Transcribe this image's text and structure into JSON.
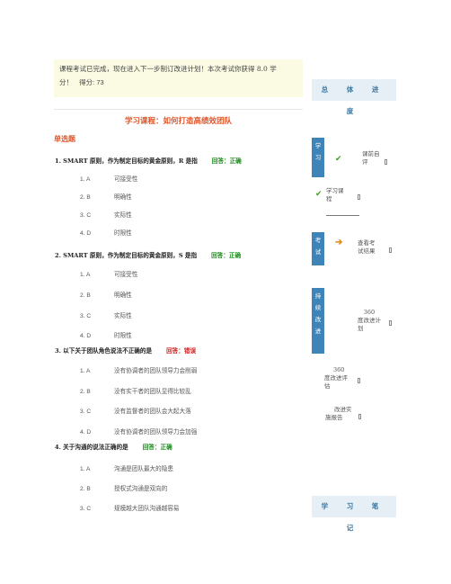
{
  "notice": {
    "line1": "课程考试已完成，现在进入下一步制订改进计划！本次考试你获得 8.0 学",
    "line2": "分！",
    "score_label": "得分: 73"
  },
  "course_title": "学习课程：如何打造高绩效团队",
  "section_title": "单选题",
  "questions": [
    {
      "text": "1. SMART 原则，作为制定目标的黄金原则，R 是指",
      "answer": "回答：正确",
      "options": [
        {
          "key": "1. A",
          "text": "可接受性"
        },
        {
          "key": "2. B",
          "text": "明确性"
        },
        {
          "key": "3. C",
          "text": "实际性"
        },
        {
          "key": "4. D",
          "text": "时限性"
        }
      ]
    },
    {
      "text": "2. SMART 原则，作为制定目标的黄金原则，S 是指",
      "answer": "回答：正确",
      "options": [
        {
          "key": "1. A",
          "text": "可接受性"
        },
        {
          "key": "2. B",
          "text": "明确性"
        },
        {
          "key": "3. C",
          "text": "实际性"
        },
        {
          "key": "4. D",
          "text": "时限性"
        }
      ]
    },
    {
      "text": "3. 以下关于团队角色说法不正确的是",
      "answer": "回答：错误",
      "options": [
        {
          "key": "1. A",
          "text": "没有协调者的团队领导力会削弱"
        },
        {
          "key": "2. B",
          "text": "没有实干者的团队显得比较乱"
        },
        {
          "key": "3. C",
          "text": "没有监督者的团队会大起大落"
        },
        {
          "key": "4. D",
          "text": "没有协调者的团队领导力会加强"
        }
      ]
    },
    {
      "text": "4. 关于沟通的说法正确的是",
      "answer": "回答：正确",
      "options": [
        {
          "key": "1. A",
          "text": "沟通是团队最大的隐患"
        },
        {
          "key": "2. B",
          "text": "授权式沟通是双向的"
        },
        {
          "key": "3. C",
          "text": "规模越大团队沟通越容易"
        }
      ]
    }
  ],
  "sidebar": {
    "progress_title": "总 体 进 度",
    "tab_study": [
      "学",
      "习"
    ],
    "tab_exam": [
      "考",
      "试"
    ],
    "tab_improve": [
      "持",
      "续",
      "改",
      "进"
    ],
    "item_precourse_1": "课前自",
    "item_precourse_2": "评",
    "item_study_1": "学习课",
    "item_study_2": "程",
    "item_result_1": "查看考",
    "item_result_2": "试结果",
    "item_plan360_1": "360",
    "item_plan360_2": "度改进计",
    "item_plan360_3": "划",
    "item_eval360_1": "360",
    "item_eval360_2": "度改进评",
    "item_eval360_3": "估",
    "item_report_1": "改进实",
    "item_report_2": "施报告",
    "notes_title": "学 习 笔 记"
  },
  "colors": {
    "accent": "#e0562a",
    "correct": "#1a8a1a",
    "wrong": "#cc2222",
    "sidebar_tab": "#3e84b8",
    "header_bg": "#e5eff5"
  }
}
